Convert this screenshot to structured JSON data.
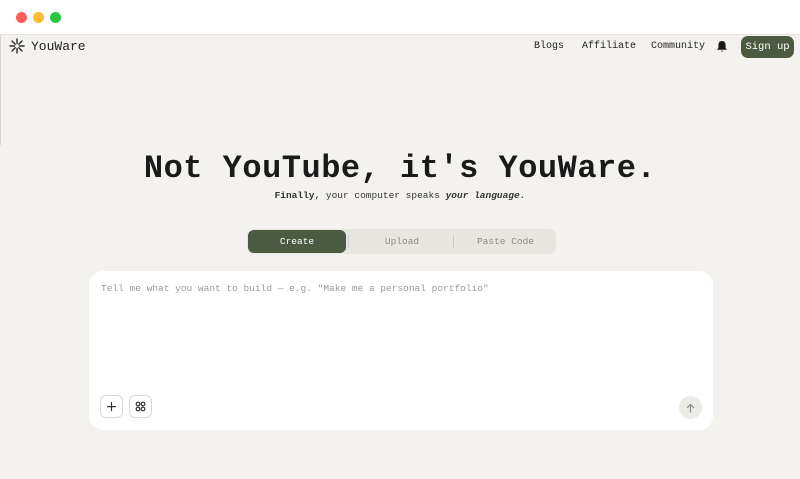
{
  "brand": {
    "name": "YouWare",
    "logo_icon": "sparkle-logo-icon"
  },
  "nav": {
    "links": [
      {
        "label": "Blogs"
      },
      {
        "label": "Affiliate"
      },
      {
        "label": "Community"
      }
    ],
    "notification_icon": "bell-icon",
    "signup_label": "Sign up"
  },
  "hero": {
    "title": "Not YouTube, it's YouWare.",
    "subtitle_bold": "Finally,",
    "subtitle_mid": " your computer speaks ",
    "subtitle_em": "your language."
  },
  "tabs": [
    {
      "label": "Create",
      "active": true
    },
    {
      "label": "Upload",
      "active": false
    },
    {
      "label": "Paste Code",
      "active": false
    }
  ],
  "prompt": {
    "value": "",
    "placeholder": "Tell me what you want to build — e.g. \"Make me a personal portfolio\""
  },
  "colors": {
    "accent": "#4c5a41",
    "background": "#f4f2ee",
    "card": "#ffffff"
  }
}
